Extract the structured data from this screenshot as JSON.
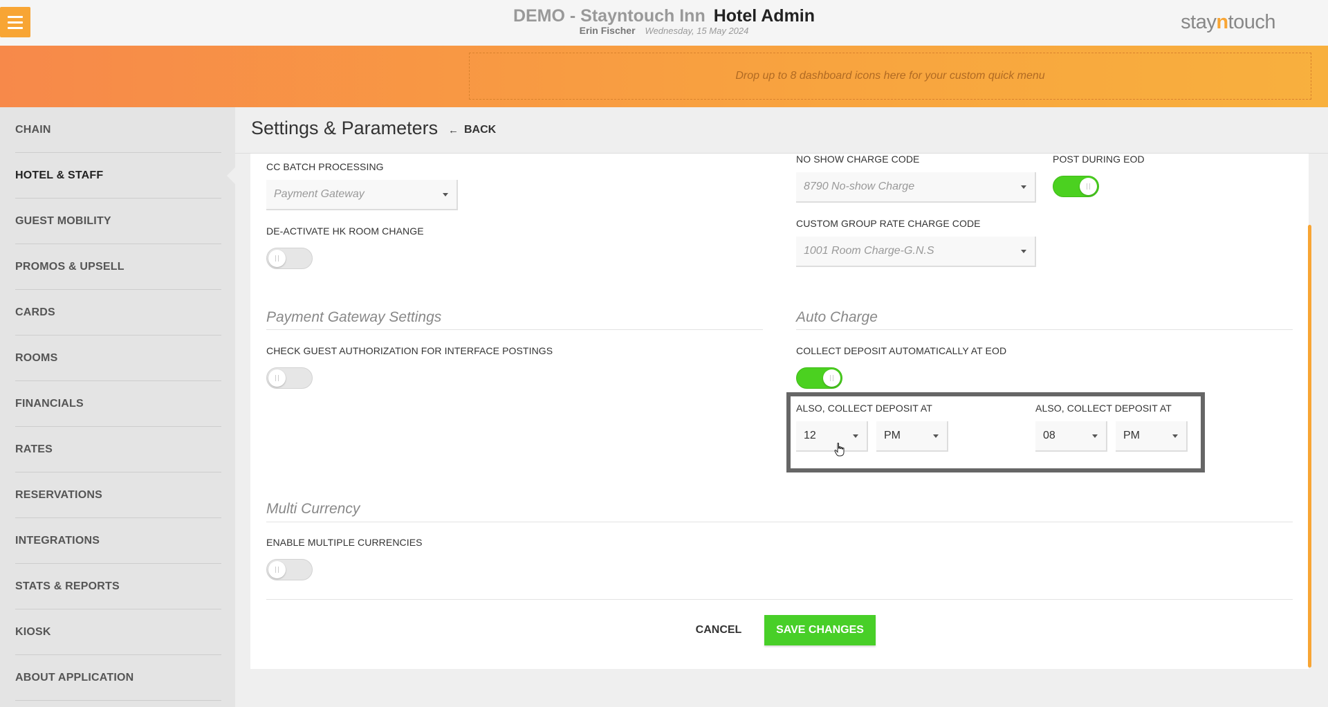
{
  "header": {
    "hotel_name": "DEMO - Stayntouch Inn",
    "app_title": "Hotel Admin",
    "user_name": "Erin Fischer",
    "date": "Wednesday, 15 May 2024",
    "brand_part1": "stay",
    "brand_part2": "n",
    "brand_part3": "touch"
  },
  "quick_menu": {
    "dropzone_text": "Drop up to 8 dashboard icons here for your custom quick menu"
  },
  "sidebar": {
    "items": [
      {
        "label": "CHAIN"
      },
      {
        "label": "HOTEL & STAFF"
      },
      {
        "label": "GUEST MOBILITY"
      },
      {
        "label": "PROMOS & UPSELL"
      },
      {
        "label": "CARDS"
      },
      {
        "label": "ROOMS"
      },
      {
        "label": "FINANCIALS"
      },
      {
        "label": "RATES"
      },
      {
        "label": "RESERVATIONS"
      },
      {
        "label": "INTEGRATIONS"
      },
      {
        "label": "STATS & REPORTS"
      },
      {
        "label": "KIOSK"
      },
      {
        "label": "ABOUT APPLICATION"
      }
    ],
    "active_index": 1
  },
  "page": {
    "title": "Settings & Parameters",
    "back_label": "BACK"
  },
  "form": {
    "cc_batch_label": "CC BATCH PROCESSING",
    "cc_batch_value": "Payment Gateway",
    "deactivate_hk_label": "DE-ACTIVATE HK ROOM CHANGE",
    "no_show_label": "NO SHOW CHARGE CODE",
    "no_show_value": "8790 No-show Charge",
    "post_eod_label": "POST DURING EOD",
    "custom_group_label": "CUSTOM GROUP RATE CHARGE CODE",
    "custom_group_value": "1001 Room Charge-G.N.S",
    "payment_gateway_section": "Payment Gateway Settings",
    "check_guest_label": "CHECK GUEST AUTHORIZATION FOR INTERFACE POSTINGS",
    "auto_charge_section": "Auto Charge",
    "collect_deposit_label": "COLLECT DEPOSIT AUTOMATICALLY AT EOD",
    "also_collect_1_label": "ALSO, COLLECT DEPOSIT AT",
    "also_collect_1_hour": "12",
    "also_collect_1_ampm": "PM",
    "also_collect_2_label": "ALSO, COLLECT DEPOSIT AT",
    "also_collect_2_hour": "08",
    "also_collect_2_ampm": "PM",
    "multi_currency_section": "Multi Currency",
    "enable_multi_label": "ENABLE MULTIPLE CURRENCIES"
  },
  "toggles": {
    "deactivate_hk": false,
    "post_eod": true,
    "check_guest": false,
    "collect_deposit": true,
    "enable_multi": false
  },
  "actions": {
    "cancel_label": "CANCEL",
    "save_label": "SAVE CHANGES"
  },
  "colors": {
    "accent_orange": "#f8a534",
    "toggle_on": "#4bd120",
    "save_green": "#48cf28"
  },
  "icons": {
    "menu": "hamburger-icon",
    "back": "arrow-left-icon",
    "dropdown": "caret-down-icon",
    "cursor": "hand-pointer-icon"
  }
}
